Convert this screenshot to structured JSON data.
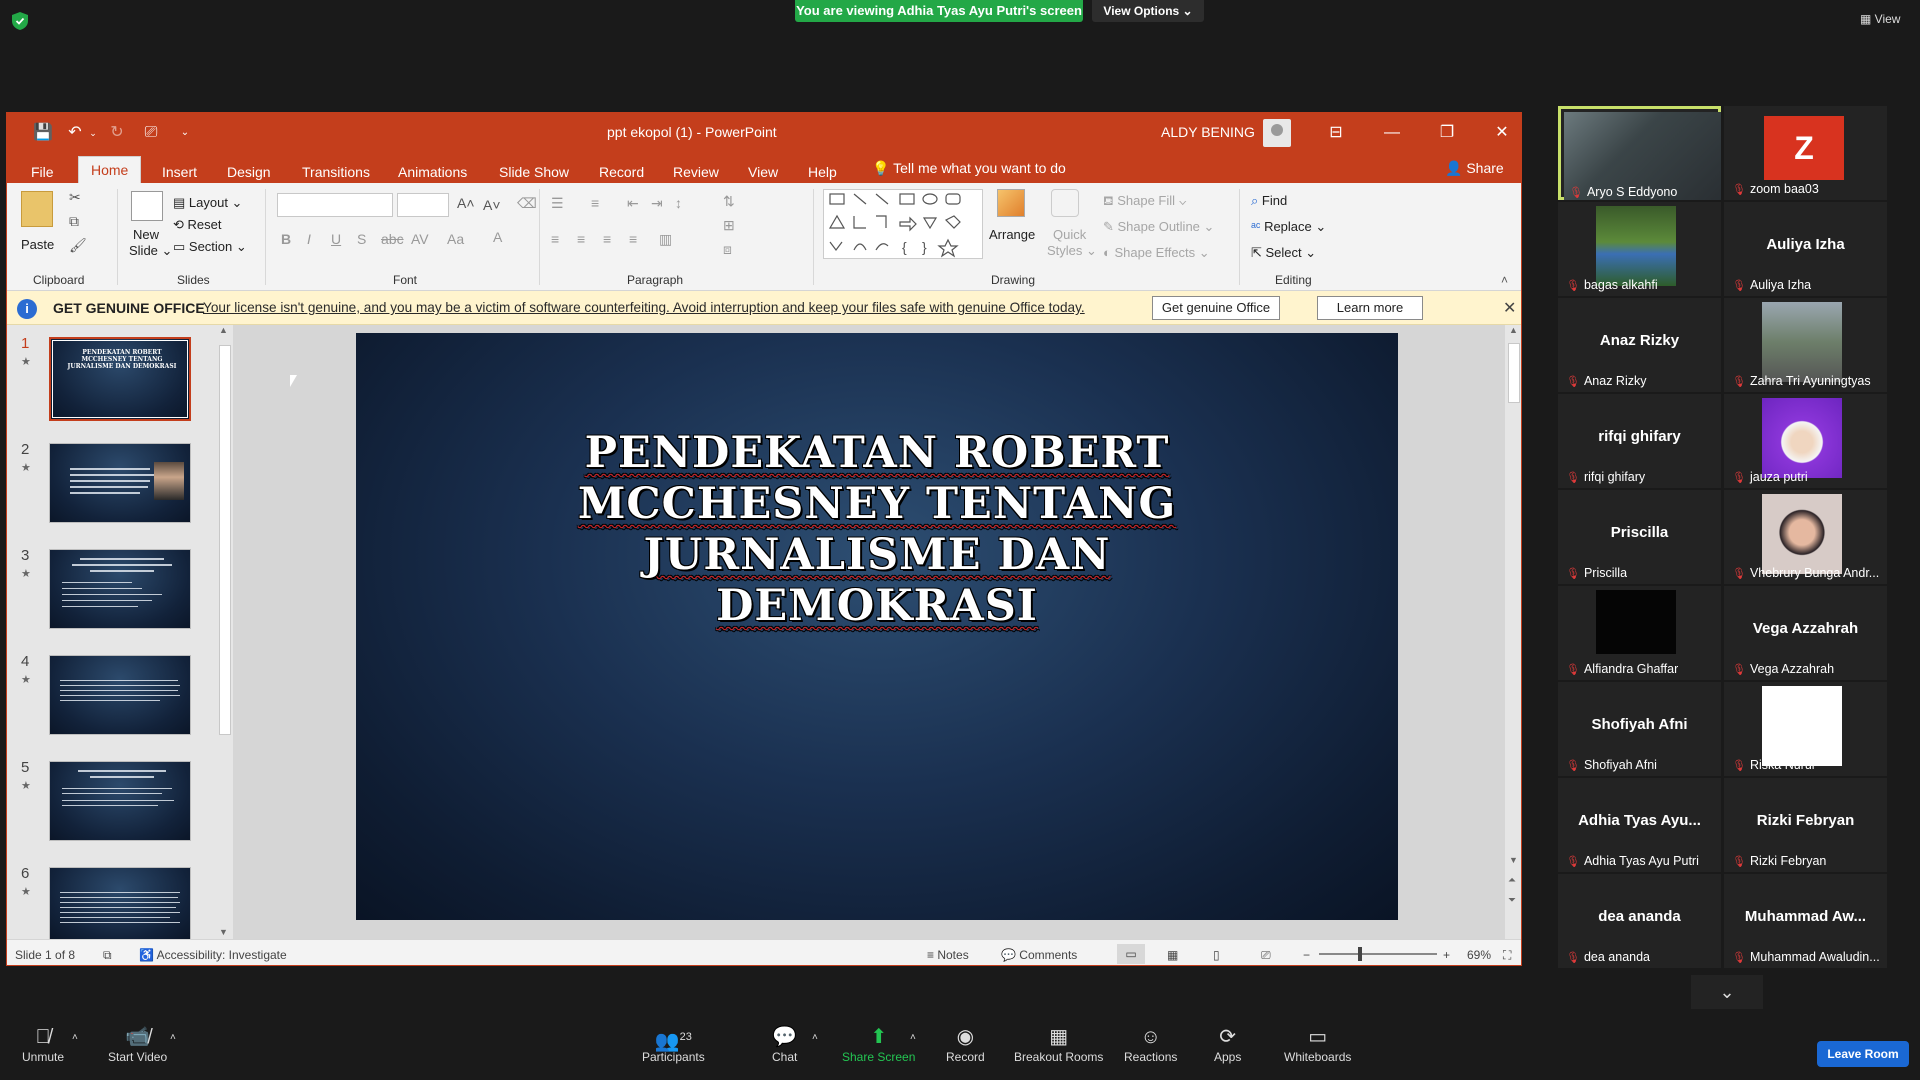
{
  "zoom": {
    "banner": "You are viewing Adhia Tyas Ayu Putri's screen",
    "view_options": "View Options ⌄",
    "view_top": "View",
    "toolbar": {
      "unmute": "Unmute",
      "start_video": "Start Video",
      "participants": "Participants",
      "participants_count": "23",
      "chat": "Chat",
      "share_screen": "Share Screen",
      "record": "Record",
      "breakout": "Breakout Rooms",
      "reactions": "Reactions",
      "apps": "Apps",
      "whiteboards": "Whiteboards",
      "leave": "Leave Room"
    },
    "gallery": [
      {
        "name": "",
        "label": "Aryo S Eddyono",
        "video": "person",
        "speaking": true
      },
      {
        "name": "Z",
        "label": "zoom baa03",
        "video": "avatar-z"
      },
      {
        "name": "",
        "label": "bagas alkahfi",
        "video": "field"
      },
      {
        "name": "Auliya Izha",
        "label": "Auliya Izha"
      },
      {
        "name": "Anaz Rizky",
        "label": "Anaz Rizky"
      },
      {
        "name": "",
        "label": "Zahra Tri Ayuningtyas",
        "video": "street"
      },
      {
        "name": "rifqi ghifary",
        "label": "rifqi ghifary"
      },
      {
        "name": "",
        "label": "jauza putri",
        "video": "hijab"
      },
      {
        "name": "Priscilla",
        "label": "Priscilla"
      },
      {
        "name": "",
        "label": "Vhebrury Bunga Andr...",
        "video": "face"
      },
      {
        "name": "",
        "label": "Alfiandra Ghaffar",
        "video": "dark"
      },
      {
        "name": "Vega Azzahrah",
        "label": "Vega Azzahrah"
      },
      {
        "name": "Shofiyah Afni",
        "label": "Shofiyah Afni"
      },
      {
        "name": "",
        "label": "Riska Nurul",
        "video": "white"
      },
      {
        "name": "Adhia Tyas Ayu...",
        "label": "Adhia Tyas Ayu Putri"
      },
      {
        "name": "Rizki Febryan",
        "label": "Rizki Febryan"
      },
      {
        "name": "dea ananda",
        "label": "dea ananda"
      },
      {
        "name": "Muhammad Aw...",
        "label": "Muhammad Awaludin..."
      }
    ]
  },
  "ppt": {
    "doc_title": "ppt ekopol (1)  -  PowerPoint",
    "user_name": "ALDY BENING",
    "tabs": [
      "File",
      "Home",
      "Insert",
      "Design",
      "Transitions",
      "Animations",
      "Slide Show",
      "Record",
      "Review",
      "View",
      "Help"
    ],
    "tell_me": "Tell me what you want to do",
    "share": "Share",
    "ribbon": {
      "clipboard": {
        "label": "Clipboard",
        "paste": "Paste"
      },
      "slides": {
        "label": "Slides",
        "new_slide_1": "New",
        "new_slide_2": "Slide ⌄",
        "layout": "Layout ⌄",
        "reset": "Reset",
        "section": "Section ⌄"
      },
      "font": {
        "label": "Font"
      },
      "paragraph": {
        "label": "Paragraph"
      },
      "drawing": {
        "label": "Drawing",
        "arrange": "Arrange",
        "quick_styles_1": "Quick",
        "quick_styles_2": "Styles ⌄",
        "shape_fill": "Shape Fill ⌄",
        "shape_outline": "Shape Outline ⌄",
        "shape_effects": "Shape Effects ⌄"
      },
      "editing": {
        "label": "Editing",
        "find": "Find",
        "replace": "Replace ⌄",
        "select": "Select ⌄"
      }
    },
    "license": {
      "title": "GET GENUINE OFFICE",
      "message": "Your license isn't genuine, and you may be a victim of software counterfeiting. Avoid interruption and keep your files safe with genuine Office today.",
      "btn_genuine": "Get genuine Office",
      "btn_learn": "Learn more"
    },
    "slides": [
      {
        "num": "1",
        "title": "PENDEKATAN ROBERT MCCHESNEY TENTANG JURNALISME DAN DEMOKRASI"
      },
      {
        "num": "2",
        "title": ""
      },
      {
        "num": "3",
        "title": "RUNI CHESNEY DI SEBUTKAN \"JURNALISTIK\" ..."
      },
      {
        "num": "4",
        "title": ""
      },
      {
        "num": "5",
        "title": "MASYARAKAT MEMBERIKAN DUKUNGAN YANG LUAS TERHADAP HAL INI"
      },
      {
        "num": "6",
        "title": ""
      }
    ],
    "current_slide": {
      "title_lines": [
        "PENDEKATAN ROBERT",
        "MCCHESNEY TENTANG",
        "JURNALISME DAN",
        "DEMOKRASI"
      ]
    },
    "status": {
      "slide_of": "Slide 1 of 8",
      "accessibility": "Accessibility: Investigate",
      "notes": "Notes",
      "comments": "Comments",
      "zoom": "69%",
      "zoom_fraction": 0.69
    }
  }
}
